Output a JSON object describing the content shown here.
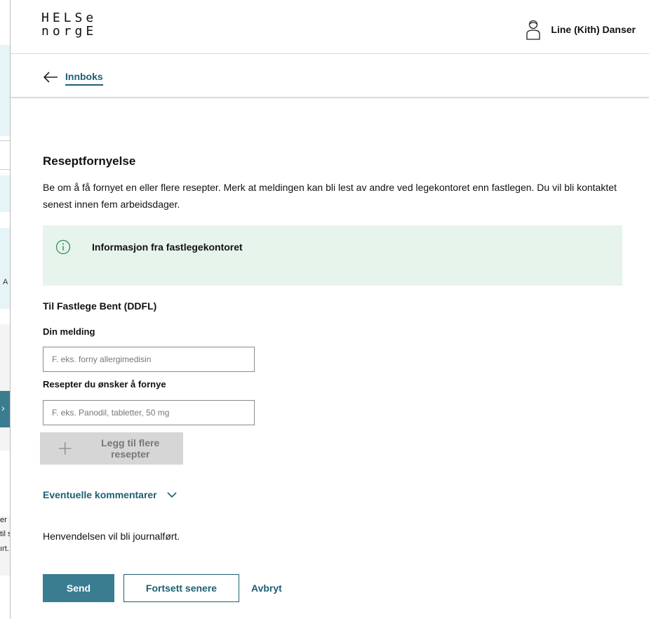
{
  "background": {
    "fragments": [
      "A",
      "er",
      "til s",
      "ırt."
    ]
  },
  "header": {
    "logo_line1": "HELSe",
    "logo_line2": "norgE",
    "user_name": "Line (Kith) Danser"
  },
  "nav": {
    "back_label": "Innboks"
  },
  "form": {
    "title": "Reseptfornyelse",
    "intro": "Be om å få fornyet en eller flere resepter. Merk at meldingen kan bli lest av andre ved legekontoret enn fastlegen. Du vil bli kontaktet senest innen fem arbeidsdager.",
    "info_title": "Informasjon fra fastlegekontoret",
    "recipient": "Til Fastlege Bent (DDFL)",
    "message_label": "Din melding",
    "message_placeholder": "F. eks. forny allergimedisin",
    "prescriptions_label": "Resepter du ønsker å fornye",
    "prescriptions_placeholder": "F. eks. Panodil, tabletter, 50 mg",
    "add_button": "Legg til flere resepter",
    "comments_toggle": "Eventuelle kommentarer",
    "journal_note": "Henvendelsen vil bli journalført."
  },
  "actions": {
    "send": "Send",
    "continue_later": "Fortsett senere",
    "cancel": "Avbryt"
  },
  "colors": {
    "primary": "#3a7d91",
    "link": "#1e5e73",
    "info_bg": "#e6f4ec"
  }
}
